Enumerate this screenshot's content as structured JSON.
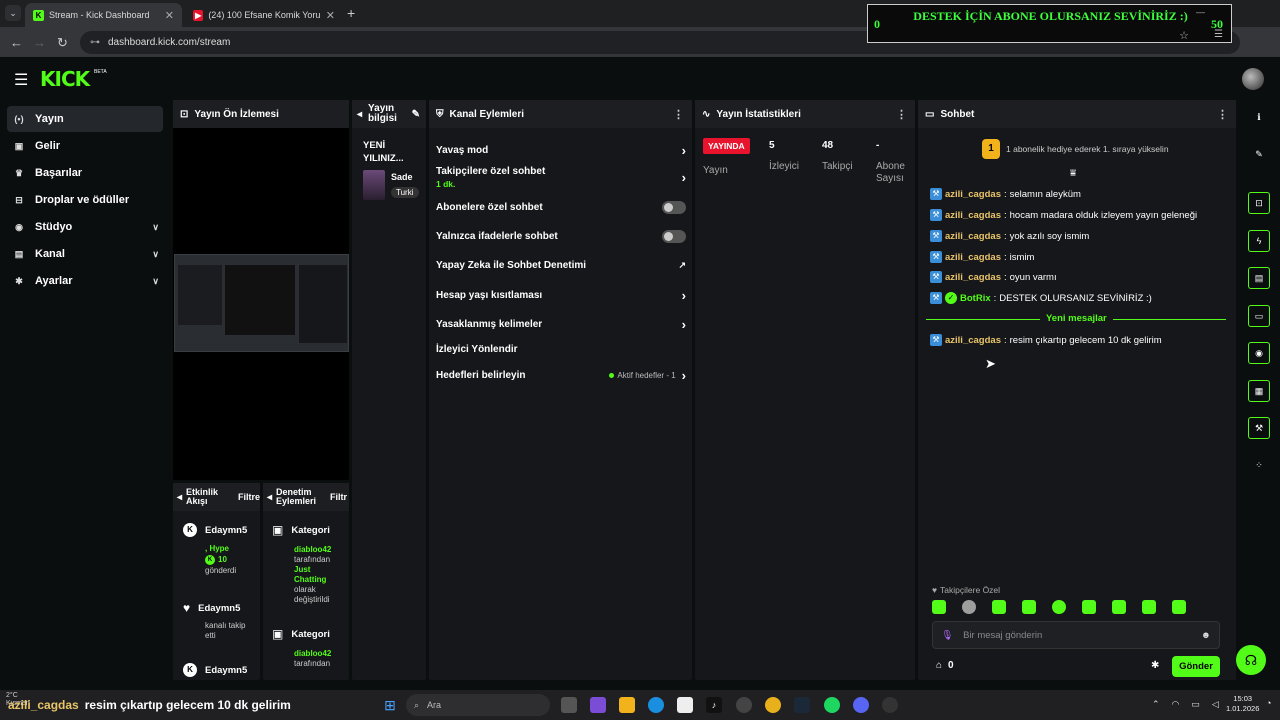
{
  "browser": {
    "tabs": [
      {
        "title": "Stream - Kick Dashboard",
        "close": "✕"
      },
      {
        "title": "(24) 100 Efsane Komik Yorum D",
        "close": "✕"
      }
    ],
    "new_tab": "+",
    "url": "dashboard.kick.com/stream"
  },
  "overlay": {
    "left_count": "0",
    "text": "DESTEK İÇİN ABONE OLURSANIZ SEVİNİRİZ :)",
    "right_count": "50"
  },
  "header": {
    "logo": "KICK",
    "beta": "BETA"
  },
  "sidebar": {
    "items": [
      {
        "label": "Yayın",
        "icon": "(•)"
      },
      {
        "label": "Gelir",
        "icon": "▣"
      },
      {
        "label": "Başarılar",
        "icon": "♛"
      },
      {
        "label": "Droplar ve ödüller",
        "icon": "⊟"
      },
      {
        "label": "Stüdyo",
        "icon": "◉",
        "chevron": "∨"
      },
      {
        "label": "Kanal",
        "icon": "▤",
        "chevron": "∨"
      },
      {
        "label": "Ayarlar",
        "icon": "✱",
        "chevron": "∨"
      }
    ]
  },
  "preview": {
    "title": "Yayın Ön İzlemesi"
  },
  "stream_info": {
    "title": "Yayın bilgisi",
    "stream_title": "YENİ YILINIZ...",
    "category": "Sade",
    "language": "Turki"
  },
  "actions": {
    "title": "Kanal Eylemleri",
    "items": [
      {
        "label": "Yavaş mod",
        "sub": ""
      },
      {
        "label": "Takipçilere özel sohbet",
        "sub": "1 dk."
      },
      {
        "label": "Abonelere özel sohbet",
        "sub": ""
      },
      {
        "label": "Yalnızca ifadelerle sohbet",
        "sub": ""
      },
      {
        "label": "Yapay Zeka ile Sohbet Denetimi",
        "sub": ""
      },
      {
        "label": "Hesap yaşı kısıtlaması",
        "sub": ""
      },
      {
        "label": "Yasaklanmış kelimeler",
        "sub": ""
      },
      {
        "label": "İzleyici Yönlendir",
        "sub": ""
      },
      {
        "label": "Hedefleri belirleyin",
        "sub": ""
      }
    ],
    "goals_status": "Aktif hedefler - 1"
  },
  "stats": {
    "title": "Yayın İstatistikleri",
    "live_badge": "YAYINDA",
    "live_label": "Yayın",
    "viewers_value": "5",
    "viewers_label": "İzleyici",
    "followers_value": "48",
    "followers_label": "Takipçi",
    "subs_value": "-",
    "subs_label": "Abone Sayısı"
  },
  "chat": {
    "title": "Sohbet",
    "gift_rank": "1",
    "gift_text": "1 abonelik hediye ederek 1. sıraya yükselin",
    "messages": [
      {
        "user": "azili_cagdas",
        "text": "selamın aleyküm"
      },
      {
        "user": "azili_cagdas",
        "text": "hocam madara olduk izleyem yayın geleneği"
      },
      {
        "user": "azili_cagdas",
        "text": "yok azılı soy ismim"
      },
      {
        "user": "azili_cagdas",
        "text": "ismim"
      },
      {
        "user": "azili_cagdas",
        "text": "oyun varmı"
      },
      {
        "user": "BotRix",
        "text": "DESTEK OLURSANIZ SEVİNİRİZ :)"
      }
    ],
    "new_messages_label": "Yeni mesajlar",
    "new_message": {
      "user": "azili_cagdas",
      "text": "resim çıkartıp gelecem 10 dk gelirim"
    },
    "follower_only": "Takipçilere Özel",
    "input_placeholder": "Bir mesaj gönderin",
    "points": "0",
    "send_label": "Gönder"
  },
  "activity": {
    "title": "Etkinlik Akışı",
    "filter": "Filtre",
    "events": [
      {
        "user": "Edaymn5",
        "lines": [
          ", Hype",
          "10",
          "gönderdi"
        ]
      },
      {
        "user": "Edaymn5",
        "lines": [
          "kanalı takip",
          "etti"
        ]
      },
      {
        "user": "Edaymn5",
        "lines": []
      }
    ]
  },
  "moderation": {
    "title": "Denetim Eylemleri",
    "filter": "Filtr",
    "events": [
      {
        "label": "Kategori",
        "by": "diabloo42",
        "lines": [
          "tarafından",
          "Just",
          "Chatting",
          "olarak",
          "değiştirildi"
        ]
      },
      {
        "label": "Kategori",
        "by": "diabloo42",
        "lines": [
          "tarafından"
        ]
      }
    ]
  },
  "taskbar": {
    "notification_user": "azili_cagdas",
    "notification_text": "resim çıkartıp gelecem 10 dk gelirim",
    "weather_temp": "2°C",
    "weather_text": "Kısmen",
    "search_placeholder": "Ara",
    "time": "15:03",
    "date": "1.01.2026"
  },
  "colors": {
    "accent": "#53fc18",
    "live": "#e8142d",
    "username": "#e9c46a"
  }
}
